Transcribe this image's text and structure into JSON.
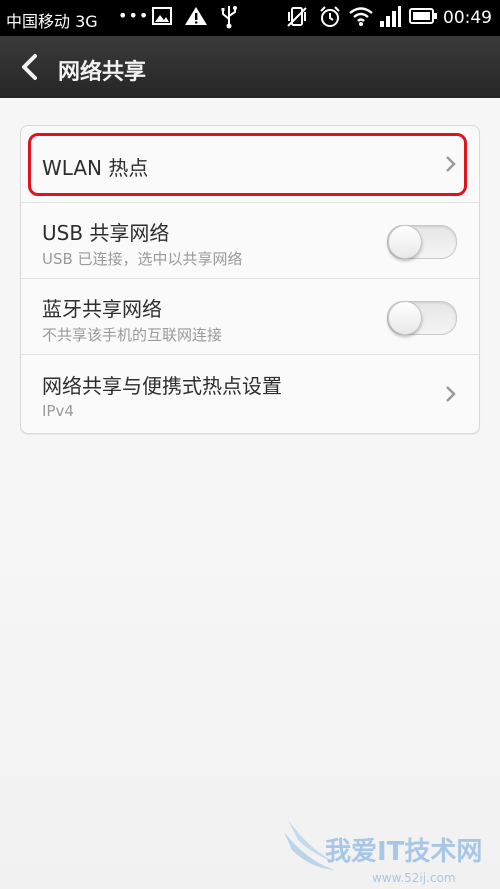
{
  "status_bar": {
    "carrier": "中国移动 3G",
    "dots": "•••",
    "time": "00:49",
    "icons": [
      "image-icon",
      "warning-icon",
      "usb-icon",
      "vibrate-icon",
      "alarm-icon",
      "wifi-icon",
      "signal-icon",
      "battery-icon"
    ]
  },
  "header": {
    "title": "网络共享",
    "back_icon": "back-arrow-icon",
    "background": "#2e2e2e"
  },
  "settings": {
    "items": [
      {
        "title": "WLAN 热点",
        "subtitle": "",
        "control": "chevron"
      },
      {
        "title": "USB 共享网络",
        "subtitle": "USB 已连接，选中以共享网络",
        "control": "toggle",
        "enabled": false
      },
      {
        "title": "蓝牙共享网络",
        "subtitle": "不共享该手机的互联网连接",
        "control": "toggle",
        "enabled": false
      },
      {
        "title": "网络共享与便携式热点设置",
        "subtitle": "IPv4",
        "control": "chevron"
      }
    ]
  },
  "annotation": {
    "highlight_color": "#e0141e"
  },
  "watermark": {
    "text": "我爱IT技术网",
    "url": "www.52ij.com"
  }
}
